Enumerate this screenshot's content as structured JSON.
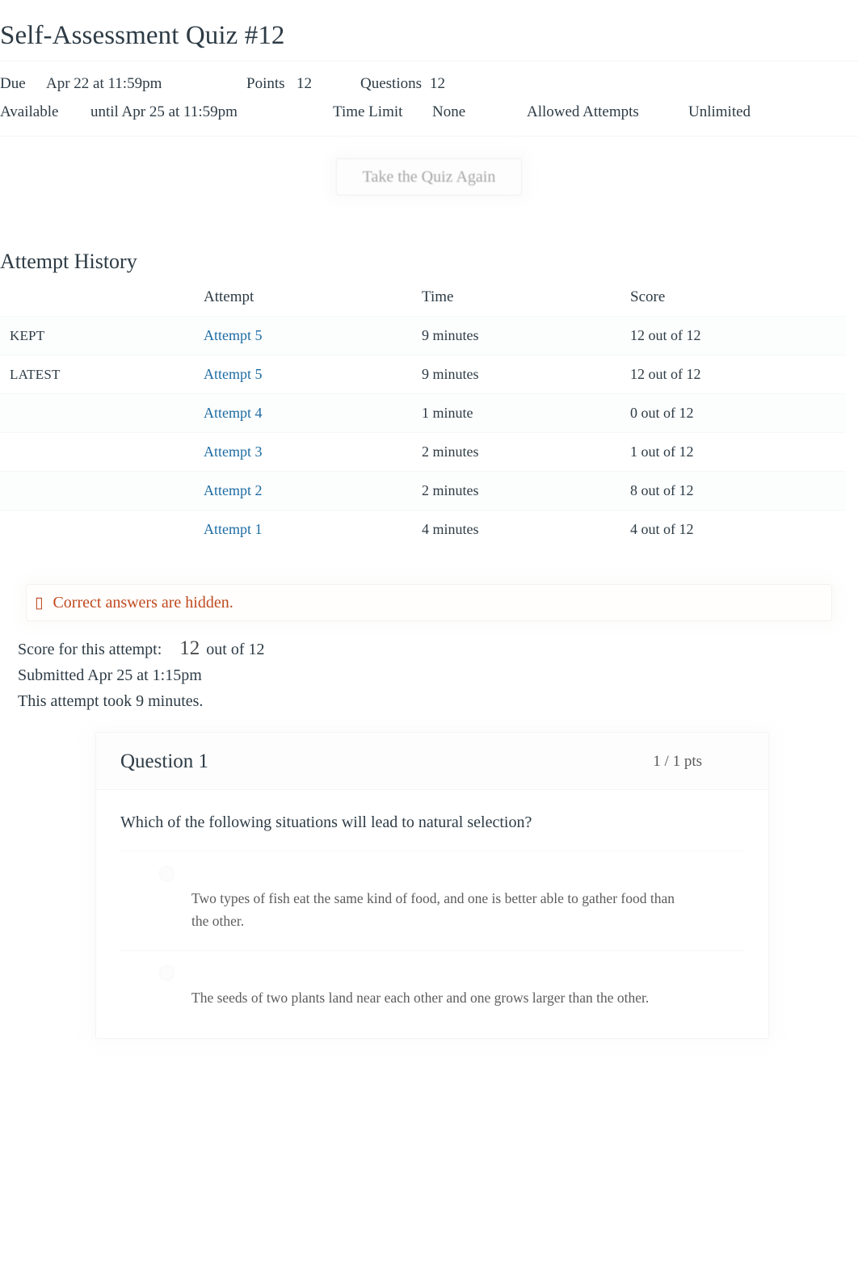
{
  "page": {
    "title": "Self-Assessment Quiz #12"
  },
  "quiz_header": {
    "due_label": "Due",
    "due_value": "Apr 22 at 11:59pm",
    "points_label": "Points",
    "points_value": "12",
    "questions_label": "Questions",
    "questions_value": "12",
    "available_label": "Available",
    "available_value": "until Apr 25 at 11:59pm",
    "time_limit_label": "Time Limit",
    "time_limit_value": "None",
    "allowed_attempts_label": "Allowed Attempts",
    "allowed_attempts_value": "Unlimited"
  },
  "actions": {
    "take_again_label": "Take the Quiz Again"
  },
  "attempt_history": {
    "heading": "Attempt History",
    "columns": {
      "flag": "",
      "attempt": "Attempt",
      "time": "Time",
      "score": "Score"
    },
    "rows": [
      {
        "flag": "KEPT",
        "attempt": "Attempt 5",
        "time": "9 minutes",
        "score": "12 out of 12"
      },
      {
        "flag": "LATEST",
        "attempt": "Attempt 5",
        "time": "9 minutes",
        "score": "12 out of 12"
      },
      {
        "flag": "",
        "attempt": "Attempt 4",
        "time": "1 minute",
        "score": "0 out of 12"
      },
      {
        "flag": "",
        "attempt": "Attempt 3",
        "time": "2 minutes",
        "score": "1 out of 12"
      },
      {
        "flag": "",
        "attempt": "Attempt 2",
        "time": "2 minutes",
        "score": "8 out of 12"
      },
      {
        "flag": "",
        "attempt": "Attempt 1",
        "time": "4 minutes",
        "score": "4 out of 12"
      }
    ]
  },
  "alert": {
    "icon": "warning-icon",
    "glyph": "▯",
    "text": "Correct answers are hidden.",
    "color": "#c0491f"
  },
  "attempt_summary": {
    "score_label": "Score for this attempt:",
    "score_value": "12",
    "score_outof": "out of 12",
    "submitted": "Submitted Apr 25 at 1:15pm",
    "duration": "This attempt took 9 minutes."
  },
  "question": {
    "name": "Question 1",
    "points": "1 / 1 pts",
    "text": "Which of the following situations will lead to natural selection?",
    "answers": [
      {
        "text": "Two types of fish eat the same kind of food, and one is better able to gather food than the other."
      },
      {
        "text": "The seeds of two plants land near each other and one grows larger than the other."
      }
    ]
  },
  "colors": {
    "link": "#1d6ca3",
    "text": "#2d3b45",
    "alert": "#c0491f",
    "muted": "#5c5c5c"
  }
}
